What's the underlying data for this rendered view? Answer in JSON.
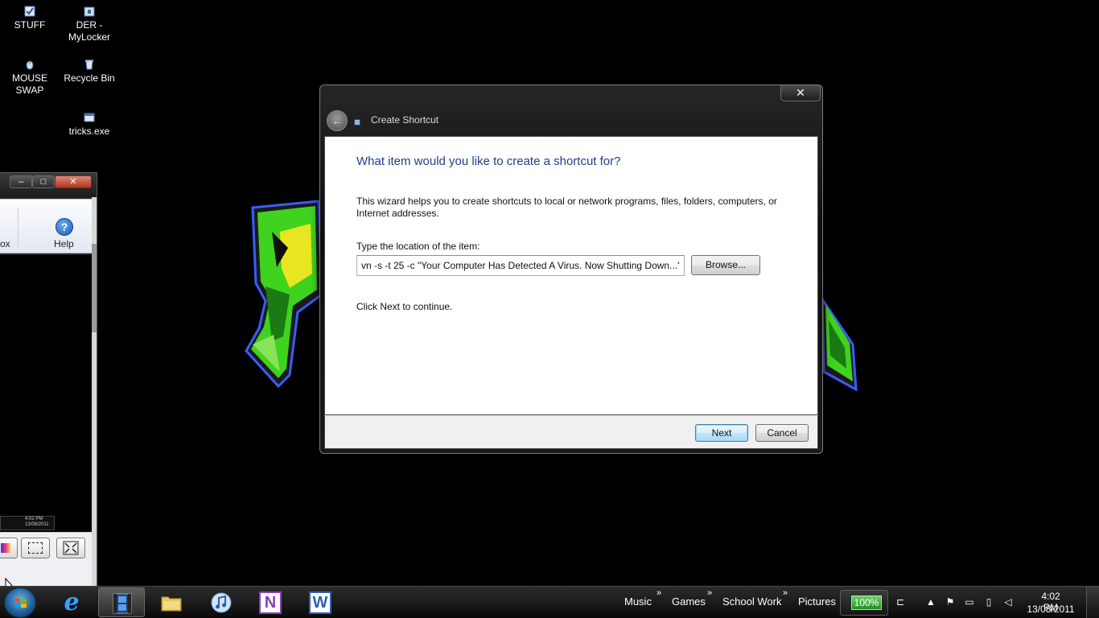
{
  "desktop": {
    "icons": [
      {
        "label": "STUFF",
        "icon": "document-shortcut-icon"
      },
      {
        "label": "DER -\nMyLocker",
        "icon": "locker-shortcut-icon"
      },
      {
        "label": "MOUSE\nSWAP",
        "icon": "mouse-shortcut-icon"
      },
      {
        "label": "Recycle Bin",
        "icon": "recycle-bin-icon"
      },
      {
        "label": "tricks.exe",
        "icon": "exe-shortcut-icon"
      }
    ]
  },
  "side_window": {
    "ribbon_left_label": "ox",
    "help_label": "Help",
    "help_icon": "?",
    "tiny_preview_text": "4:02 PM 13/08/2011",
    "caption": {
      "minimize": "–",
      "maximize": "□",
      "close": "✕"
    }
  },
  "dialog": {
    "title": "Create Shortcut",
    "close_glyph": "✕",
    "back_glyph": "←",
    "heading": "What item would you like to create a shortcut for?",
    "description": "This wizard helps you to create shortcuts to local or network programs, files, folders, computers, or Internet addresses.",
    "location_label": "Type the location of the item:",
    "location_value": "vn -s -t 25 -c \"Your Computer Has Detected A Virus. Now Shutting Down...\"",
    "browse_label": "Browse...",
    "continue_text": "Click Next to continue.",
    "next_label": "Next",
    "cancel_label": "Cancel"
  },
  "taskbar": {
    "apps": [
      {
        "name": "internet-explorer",
        "icon": "internet-explorer-icon",
        "active": false
      },
      {
        "name": "movie-maker",
        "icon": "film-strip-icon",
        "active": true
      },
      {
        "name": "windows-explorer",
        "icon": "folder-icon",
        "active": false
      },
      {
        "name": "itunes",
        "icon": "music-note-icon",
        "active": false
      },
      {
        "name": "onenote",
        "icon": "onenote-icon",
        "active": false
      },
      {
        "name": "word",
        "icon": "word-icon",
        "active": false
      }
    ],
    "toolbars": [
      "Music",
      "Games",
      "School Work",
      "Pictures"
    ],
    "chevron": "»",
    "battery_text": "100%",
    "battery_level": 1.0,
    "time": "4:02 PM",
    "date": "13/08/2011",
    "onenote_letter": "N",
    "word_letter": "W",
    "ie_letter": "e"
  },
  "colors": {
    "dialog_heading": "#1e3f8a",
    "graffiti_green": "#3fd21e",
    "graffiti_yellow": "#e8e620",
    "graffiti_outline": "#3a5cff",
    "battery_green": "#2faa2f"
  }
}
